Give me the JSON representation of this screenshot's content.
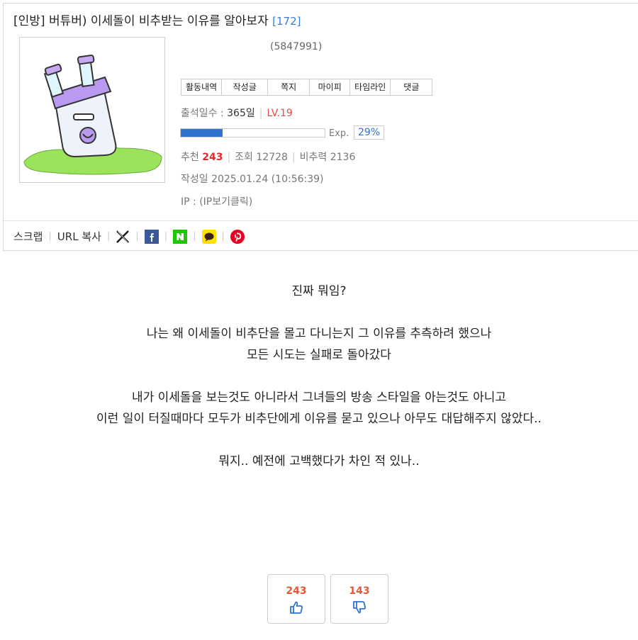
{
  "post": {
    "title": "[인방] 버튜버) 이세돌이 비추받는 이유를 알아보자",
    "comment_count": "[172]",
    "user_id": "(5847991)",
    "menu": [
      "활동내역",
      "작성글",
      "쪽지",
      "마이피",
      "타임라인",
      "댓글"
    ],
    "attendance_label": "출석일수 : ",
    "attendance_value": "365일",
    "level": "LV.19",
    "exp_label": "Exp.",
    "exp_pct": "29%",
    "exp_fraction": 0.29,
    "recommend_label": "추천 ",
    "recommend_value": "243",
    "views": "조회 12728",
    "unrecommend_ratio": "비추력 2136",
    "date": "작성일 2025.01.24 (10:56:39)",
    "ip": "IP : (IP보기클릭)"
  },
  "share": {
    "scrap": "스크랩",
    "url_copy": "URL 복사"
  },
  "content": {
    "line1": "진짜 뭐임?",
    "line2": "나는 왜 이세돌이 비추단을 몰고 다니는지 그 이유를 추측하려 했으나",
    "line3": "모든 시도는 실패로 돌아갔다",
    "line4": "내가 이세돌을 보는것도 아니라서 그녀들의 방송 스타일을 아는것도 아니고",
    "line5": "이런 일이 터질때마다 모두가 비추단에게 이유를 묻고 있으나 아무도 대답해주지 않았다..",
    "line6": "뭐지.. 예전에 고백했다가 차인 적 있나.."
  },
  "votes": {
    "up": "243",
    "down": "143"
  },
  "colors": {
    "accent_blue": "#2f73d0",
    "level_red": "#e04b4b",
    "vote_red": "#e05a3a"
  },
  "icons": [
    "x-icon",
    "facebook-icon",
    "naver-icon",
    "kakaotalk-icon",
    "pinterest-icon",
    "thumbs-up-icon",
    "thumbs-down-icon"
  ]
}
